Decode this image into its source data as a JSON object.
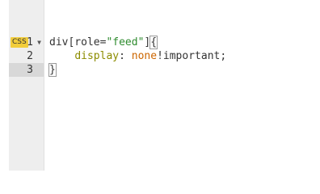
{
  "editor": {
    "language_badge": "CSS",
    "gutter": {
      "fold_icon": "triangle-down",
      "lines": [
        "1",
        "2",
        "3"
      ],
      "active_line": "3"
    },
    "code": {
      "line1": {
        "selector_a": "div[role=",
        "string": "\"feed\"",
        "selector_b": "]",
        "brace_open": "{"
      },
      "line2": {
        "indent": "    ",
        "property": "display",
        "colon": ": ",
        "value": "none",
        "important": "!important",
        "semicolon": ";"
      },
      "line3": {
        "brace_close": "}"
      }
    },
    "colors": {
      "string": "#2e8b2e",
      "property": "#8c8c00",
      "value": "#cc6600",
      "badge": "#f2cd3b"
    }
  }
}
